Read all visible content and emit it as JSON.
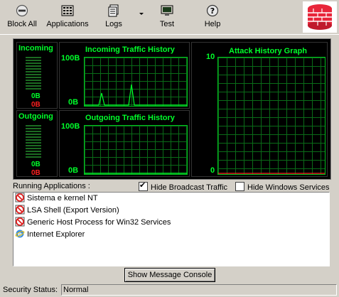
{
  "toolbar": {
    "buttons": [
      {
        "label": "Block All",
        "icon": "block-all-icon"
      },
      {
        "label": "Applications",
        "icon": "applications-icon"
      },
      {
        "label": "Logs",
        "icon": "logs-icon"
      },
      {
        "label": "Test",
        "icon": "test-icon"
      },
      {
        "label": "Help",
        "icon": "help-icon"
      }
    ],
    "logo_icon": "firewall-brick-icon"
  },
  "monitor": {
    "incoming_meter": {
      "title": "Incoming",
      "value_green": "0B",
      "value_red": "0B"
    },
    "outgoing_meter": {
      "title": "Outgoing",
      "value_green": "0B",
      "value_red": "0B"
    },
    "incoming_history": {
      "title": "Incoming Traffic History",
      "axis_top": "100B",
      "axis_bottom": "0B"
    },
    "outgoing_history": {
      "title": "Outgoing Traffic History",
      "axis_top": "100B",
      "axis_bottom": "0B"
    },
    "attack_history": {
      "title": "Attack History Graph",
      "axis_top": "10",
      "axis_bottom": "0"
    },
    "colors": {
      "grid": "#0a6b18",
      "line": "#00ff2a",
      "text": "#00ff2a",
      "alert": "#ff2020"
    }
  },
  "apps_section": {
    "label": "Running Applications :",
    "hide_broadcast_label": "Hide Broadcast Traffic",
    "hide_broadcast_checked": true,
    "hide_windows_services_label": "Hide Windows Services",
    "hide_windows_services_checked": false,
    "items": [
      {
        "name": "Sistema e kernel NT",
        "icon": "blocked-icon"
      },
      {
        "name": "LSA Shell (Export Version)",
        "icon": "blocked-icon"
      },
      {
        "name": "Generic Host Process for Win32 Services",
        "icon": "blocked-icon"
      },
      {
        "name": "Internet Explorer",
        "icon": "internet-explorer-icon"
      }
    ]
  },
  "console_button": {
    "label": "Show Message Console"
  },
  "statusbar": {
    "label": "Security Status:",
    "value": "Normal"
  }
}
